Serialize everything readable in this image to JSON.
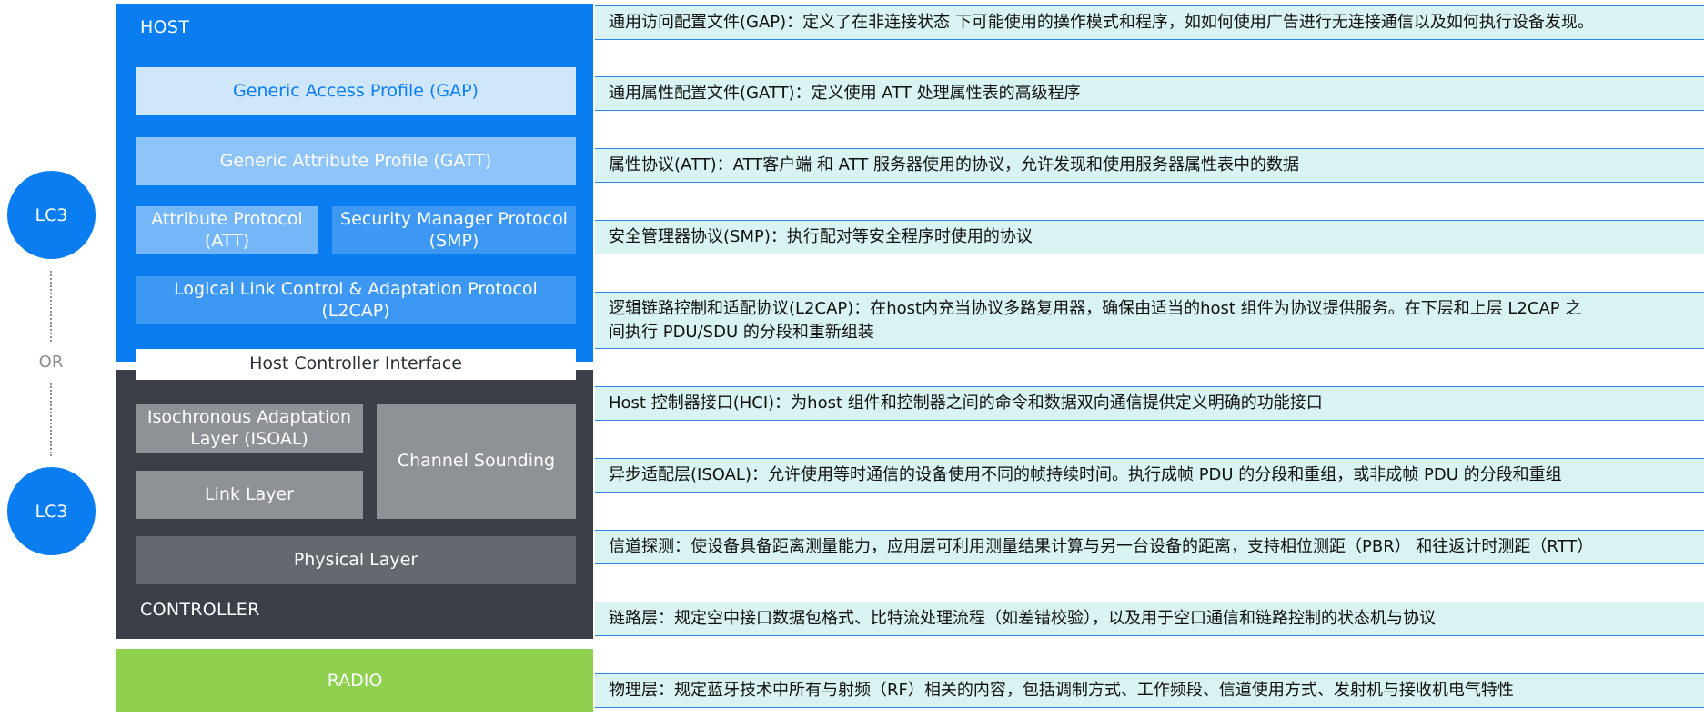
{
  "lc3": {
    "top_label": "LC3",
    "or_label": "OR",
    "bottom_label": "LC3"
  },
  "stack": {
    "host_label": "HOST",
    "gap": "Generic Access Profile (GAP)",
    "gatt": "Generic Attribute Profile (GATT)",
    "att": "Attribute Protocol\n(ATT)",
    "smp": "Security Manager Protocol\n(SMP)",
    "l2cap": "Logical Link Control & Adaptation Protocol\n(L2CAP)",
    "hci": "Host Controller Interface",
    "isoal": "Isochronous Adaptation\nLayer (ISOAL)",
    "channel_sounding": "Channel Sounding",
    "link_layer": "Link Layer",
    "physical_layer": "Physical Layer",
    "controller_label": "CONTROLLER",
    "radio": "RADIO"
  },
  "descriptions": [
    "通用访问配置文件(GAP)：定义了在非连接状态 下可能使用的操作模式和程序，如如何使用广告进行无连接通信以及如何执行设备发现。",
    "通用属性配置文件(GATT)：定义使用 ATT 处理属性表的高级程序",
    "属性协议(ATT)：ATT客户端 和 ATT 服务器使用的协议，允许发现和使用服务器属性表中的数据",
    "安全管理器协议(SMP)：执行配对等安全程序时使用的协议",
    "逻辑链路控制和适配协议(L2CAP)：在host内充当协议多路复用器，确保由适当的host 组件为协议提供服务。在下层和上层 L2CAP 之\n间执行 PDU/SDU 的分段和重新组装",
    "Host 控制器接口(HCI)：为host 组件和控制器之间的命令和数据双向通信提供定义明确的功能接口",
    "异步适配层(ISOAL)：允许使用等时通信的设备使用不同的帧持续时间。执行成帧 PDU 的分段和重组，或非成帧 PDU 的分段和重组",
    "信道探测：使设备具备距离测量能力，应用层可利用测量结果计算与另一台设备的距离，支持相位测距（PBR） 和往返计时测距（RTT）",
    "链路层：规定空中接口数据包格式、比特流处理流程（如差错校验），以及用于空口通信和链路控制的状态机与协议",
    "物理层：规定蓝牙技术中所有与射频（RF）相关的内容，包括调制方式、工作频段、信道使用方式、发射机与接收机电气特性"
  ],
  "colors": {
    "host_blue": "#0a7ef0",
    "controller_gray": "#3b4048",
    "radio_green": "#8fd14f",
    "description_bg": "#d8f3f1",
    "description_border": "#2f86e6"
  }
}
